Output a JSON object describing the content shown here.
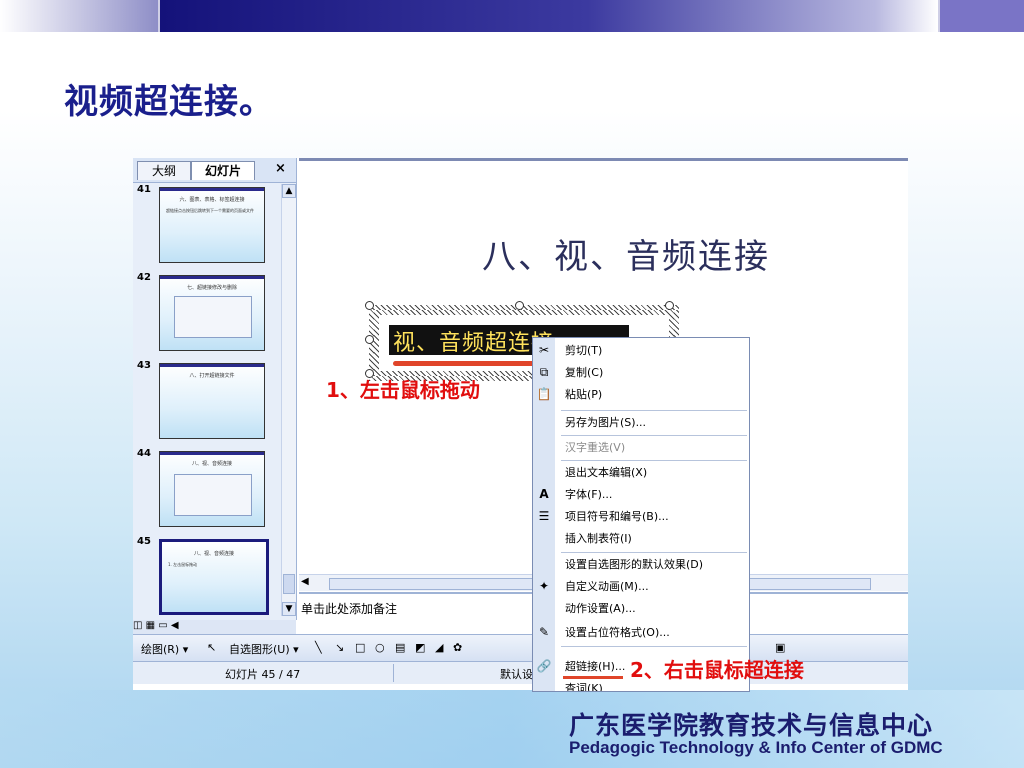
{
  "page_title": "视频超连接。",
  "colors": {
    "title": "#1a1f8c",
    "annotation": "#e10e0e",
    "accent": "#1b1d6e"
  },
  "outline_tabs": {
    "outline": "大纲",
    "slides": "幻灯片",
    "close": "×"
  },
  "thumbnails": [
    {
      "num": "41",
      "title": "六、图表、表格、标签超连接",
      "text": "超链接点击按钮后跳转到下一个需要的页面或文件"
    },
    {
      "num": "42",
      "title": "七、超链接修改与删除",
      "text": ""
    },
    {
      "num": "43",
      "title": "八、打开超链接文件",
      "text": ""
    },
    {
      "num": "44",
      "title": "八、视、音频连接",
      "text": "1. 左击鼠标拖动"
    },
    {
      "num": "45",
      "title": "八、视、音频连接",
      "text": "1. 左击鼠标拖动"
    }
  ],
  "slide": {
    "title": "八、视、音频连接",
    "selected_text": "视、音频超连接"
  },
  "notes_placeholder": "单击此处添加备注",
  "drawing_toolbar": {
    "draw": "绘图(R) ▾",
    "autoshape": "自选图形(U) ▾"
  },
  "status": {
    "slide_counter": "幻灯片 45 / 47",
    "design": "默认设"
  },
  "annotations": {
    "step1": "1、左击鼠标拖动",
    "step2": "2、右击鼠标超连接"
  },
  "context_menu": [
    {
      "label": "剪切(T)",
      "icon": "scissors-icon"
    },
    {
      "label": "复制(C)",
      "icon": "copy-icon"
    },
    {
      "label": "粘贴(P)",
      "icon": "paste-icon"
    },
    {
      "label": "另存为图片(S)...",
      "icon": ""
    },
    {
      "label": "汉字重选(V)",
      "icon": "",
      "disabled": true
    },
    {
      "label": "退出文本编辑(X)",
      "icon": ""
    },
    {
      "label": "字体(F)...",
      "icon": "font-icon"
    },
    {
      "label": "项目符号和编号(B)...",
      "icon": "bullets-icon"
    },
    {
      "label": "插入制表符(I)",
      "icon": ""
    },
    {
      "label": "设置自选图形的默认效果(D)",
      "icon": ""
    },
    {
      "label": "自定义动画(M)...",
      "icon": "animation-icon"
    },
    {
      "label": "动作设置(A)...",
      "icon": ""
    },
    {
      "label": "设置占位符格式(O)...",
      "icon": "format-icon"
    },
    {
      "label": "超链接(H)...",
      "icon": "hyperlink-icon"
    },
    {
      "label": "查词(K)",
      "icon": ""
    }
  ],
  "footer": {
    "org_cn": "广东医学院教育技术与信息中心",
    "org_en": "Pedagogic Technology & Info Center of GDMC"
  }
}
